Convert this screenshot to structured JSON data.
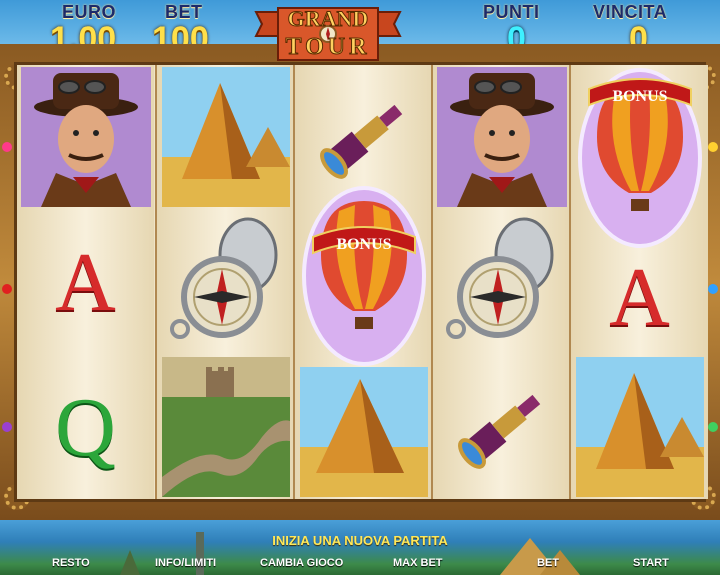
{
  "hud": {
    "credit_label": "EURO",
    "credit_value": "1.00",
    "bet_label": "BET",
    "bet_value": "100",
    "points_label": "PUNTI",
    "points_value": "0",
    "win_label": "VINCITA",
    "win_value": "0"
  },
  "logo": {
    "line1": "GRAND",
    "line2": "TOUR"
  },
  "reels": [
    [
      "explorer",
      "A",
      "Q"
    ],
    [
      "pyramids",
      "compass",
      "great-wall"
    ],
    [
      "spyglass",
      "bonus-balloon",
      "pyramids"
    ],
    [
      "explorer",
      "compass",
      "spyglass"
    ],
    [
      "bonus-balloon",
      "A",
      "pyramids"
    ]
  ],
  "bonus_text": "BONUS",
  "message": "INIZIA UNA NUOVA PARTITA",
  "buttons": {
    "resto": "RESTO",
    "info": "INFO/LIMITI",
    "change": "CAMBIA GIOCO",
    "max_bet": "MAX BET",
    "bet": "BET",
    "start": "START"
  },
  "colors": {
    "hud_value": "#ffe04a",
    "hud_value_alt": "#3ef0ff",
    "hud_label": "#1c2a6b",
    "letter_a": "#d62b2b",
    "letter_q": "#2ca63a",
    "frame": "#c08a3c"
  }
}
